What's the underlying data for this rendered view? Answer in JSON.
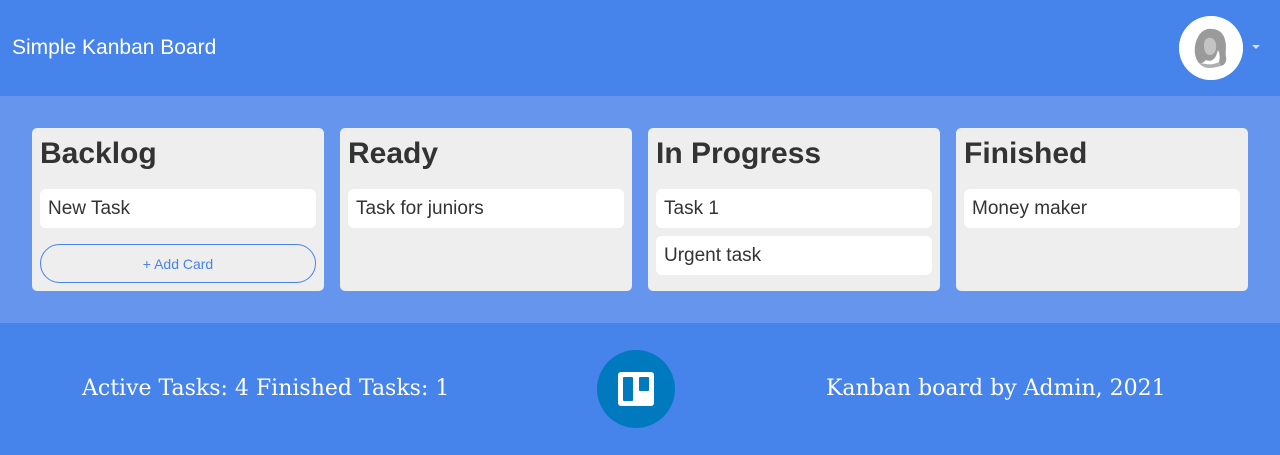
{
  "header": {
    "title": "Simple Kanban Board",
    "avatar_icon": "user-avatar-icon",
    "menu_icon": "caret-down-icon"
  },
  "board": {
    "columns": [
      {
        "title": "Backlog",
        "cards": [
          "New Task"
        ],
        "add_card_label": "+ Add Card"
      },
      {
        "title": "Ready",
        "cards": [
          "Task for juniors"
        ]
      },
      {
        "title": "In Progress",
        "cards": [
          "Task 1",
          "Urgent task"
        ]
      },
      {
        "title": "Finished",
        "cards": [
          "Money maker"
        ]
      }
    ]
  },
  "footer": {
    "stats": "Active Tasks: 4 Finished Tasks: 1",
    "logo_icon": "trello-logo-icon",
    "credits": "Kanban board by Admin, 2021"
  },
  "colors": {
    "primary": "#4683ea",
    "board_background": "#6595ed",
    "column_background": "#eeeeee",
    "card_background": "#ffffff",
    "logo_blue": "#0079bf",
    "text_dark": "#333333"
  }
}
